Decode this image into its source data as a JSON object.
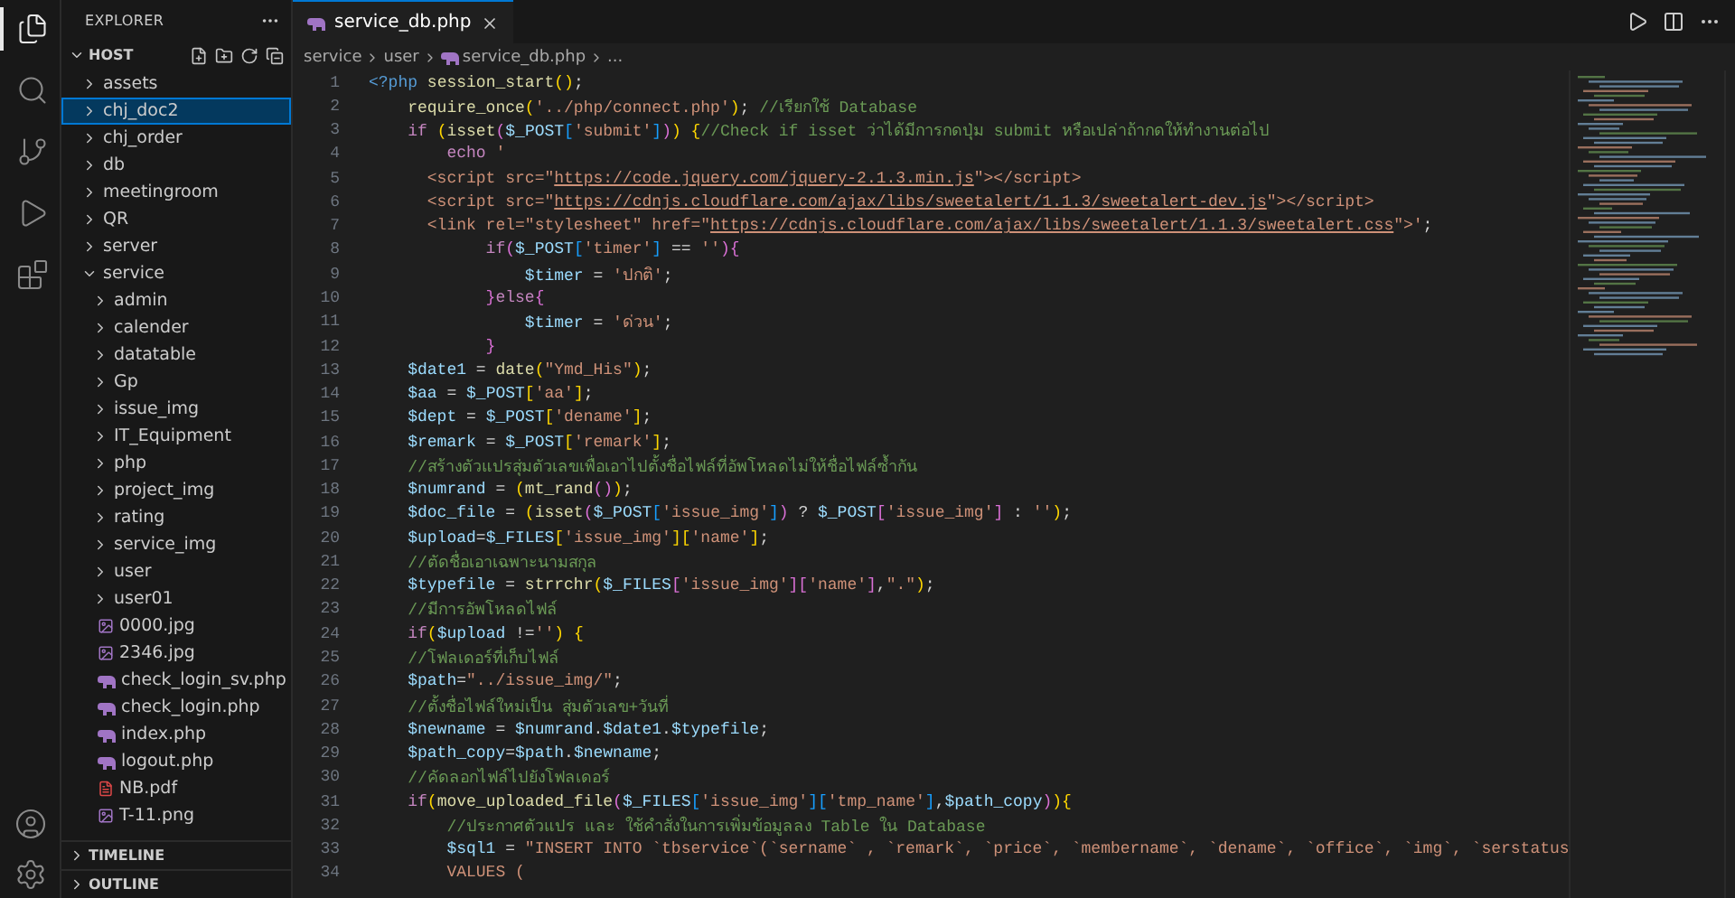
{
  "activity_bar": {
    "items": [
      {
        "kind": "explorer",
        "selected": true
      },
      {
        "kind": "search",
        "selected": false
      },
      {
        "kind": "source-control",
        "selected": false
      },
      {
        "kind": "run-debug",
        "selected": false
      },
      {
        "kind": "extensions",
        "selected": false
      }
    ],
    "bottom_items": [
      {
        "kind": "accounts"
      },
      {
        "kind": "settings"
      }
    ]
  },
  "sidebar": {
    "title": "EXPLORER",
    "section": {
      "title": "HOST",
      "expanded": true
    },
    "tree": [
      {
        "label": "assets",
        "kind": "folder",
        "expanded": false,
        "selected": false
      },
      {
        "label": "chj_doc2",
        "kind": "folder",
        "expanded": false,
        "selected": true
      },
      {
        "label": "chj_order",
        "kind": "folder",
        "expanded": false,
        "selected": false
      },
      {
        "label": "db",
        "kind": "folder",
        "expanded": false,
        "selected": false
      },
      {
        "label": "meetingroom",
        "kind": "folder",
        "expanded": false,
        "selected": false
      },
      {
        "label": "QR",
        "kind": "folder",
        "expanded": false,
        "selected": false
      },
      {
        "label": "server",
        "kind": "folder",
        "expanded": false,
        "selected": false
      },
      {
        "label": "service",
        "kind": "folder",
        "expanded": true,
        "selected": false,
        "children": [
          {
            "label": "admin",
            "kind": "folder",
            "expanded": false,
            "selected": false
          },
          {
            "label": "calender",
            "kind": "folder",
            "expanded": false,
            "selected": false
          },
          {
            "label": "datatable",
            "kind": "folder",
            "expanded": false,
            "selected": false
          },
          {
            "label": "Gp",
            "kind": "folder",
            "expanded": false,
            "selected": false
          },
          {
            "label": "issue_img",
            "kind": "folder",
            "expanded": false,
            "selected": false
          },
          {
            "label": "IT_Equipment",
            "kind": "folder",
            "expanded": false,
            "selected": false
          },
          {
            "label": "php",
            "kind": "folder",
            "expanded": false,
            "selected": false
          },
          {
            "label": "project_img",
            "kind": "folder",
            "expanded": false,
            "selected": false
          },
          {
            "label": "rating",
            "kind": "folder",
            "expanded": false,
            "selected": false
          },
          {
            "label": "service_img",
            "kind": "folder",
            "expanded": false,
            "selected": false
          },
          {
            "label": "user",
            "kind": "folder",
            "expanded": false,
            "selected": false
          },
          {
            "label": "user01",
            "kind": "folder",
            "expanded": false,
            "selected": false
          },
          {
            "label": "0000.jpg",
            "kind": "image",
            "selected": false
          },
          {
            "label": "2346.jpg",
            "kind": "image",
            "selected": false
          },
          {
            "label": "check_login_sv.php",
            "kind": "php",
            "selected": false
          },
          {
            "label": "check_login.php",
            "kind": "php",
            "selected": false
          },
          {
            "label": "index.php",
            "kind": "php",
            "selected": false
          },
          {
            "label": "logout.php",
            "kind": "php",
            "selected": false
          },
          {
            "label": "NB.pdf",
            "kind": "pdf",
            "selected": false
          },
          {
            "label": "T-11.png",
            "kind": "image",
            "selected": false
          }
        ]
      }
    ],
    "panels": [
      {
        "title": "TIMELINE",
        "expanded": false
      },
      {
        "title": "OUTLINE",
        "expanded": false
      }
    ]
  },
  "editor": {
    "tabs": [
      {
        "label": "service_db.php",
        "selected": true
      }
    ],
    "breadcrumb": [
      {
        "kind": "folder",
        "label": "service"
      },
      {
        "kind": "folder",
        "label": "user"
      },
      {
        "kind": "php",
        "label": "service_db.php"
      },
      {
        "kind": "more",
        "label": "..."
      }
    ],
    "lines": [
      {
        "number": "1",
        "tokens": [
          {
            "kind": "tag",
            "text": "<?php"
          },
          {
            "kind": "fn",
            "text": " session_start"
          },
          {
            "kind": "b1",
            "text": "()"
          },
          {
            "kind": "pun",
            "text": ";"
          }
        ]
      },
      {
        "number": "2",
        "tokens": [
          {
            "kind": "fn",
            "text": "    require_once"
          },
          {
            "kind": "b1",
            "text": "("
          },
          {
            "kind": "str",
            "text": "'../php/connect.php'"
          },
          {
            "kind": "b1",
            "text": ")"
          },
          {
            "kind": "pun",
            "text": "; "
          },
          {
            "kind": "cmt",
            "text": "//เรียกใช้ Database"
          }
        ]
      },
      {
        "number": "3",
        "tokens": [
          {
            "kind": "kw",
            "text": "    if "
          },
          {
            "kind": "b1",
            "text": "("
          },
          {
            "kind": "fn",
            "text": "isset"
          },
          {
            "kind": "b2",
            "text": "("
          },
          {
            "kind": "var",
            "text": "$_POST"
          },
          {
            "kind": "b3",
            "text": "["
          },
          {
            "kind": "str",
            "text": "'submit'"
          },
          {
            "kind": "b3",
            "text": "]"
          },
          {
            "kind": "b2",
            "text": ")"
          },
          {
            "kind": "b1",
            "text": ") {"
          },
          {
            "kind": "cmt",
            "text": "//Check if isset ว่าได้มีการกดปุ่ม submit หรือเปล่าถ้ากดให้ทำงานต่อไป"
          }
        ]
      },
      {
        "number": "4",
        "tokens": [
          {
            "kind": "kw",
            "text": "        echo "
          },
          {
            "kind": "str",
            "text": "'"
          }
        ]
      },
      {
        "number": "5",
        "tokens": [
          {
            "kind": "str",
            "text": "      <script src=\""
          },
          {
            "kind": "link",
            "text": "https://code.jquery.com/jquery-2.1.3.min.js"
          },
          {
            "kind": "str",
            "text": "\"></script>"
          }
        ]
      },
      {
        "number": "6",
        "tokens": [
          {
            "kind": "str",
            "text": "      <script src=\""
          },
          {
            "kind": "link",
            "text": "https://cdnjs.cloudflare.com/ajax/libs/sweetalert/1.1.3/sweetalert-dev.js"
          },
          {
            "kind": "str",
            "text": "\"></script>"
          }
        ]
      },
      {
        "number": "7",
        "tokens": [
          {
            "kind": "str",
            "text": "      <link rel=\"stylesheet\" href=\""
          },
          {
            "kind": "link",
            "text": "https://cdnjs.cloudflare.com/ajax/libs/sweetalert/1.1.3/sweetalert.css"
          },
          {
            "kind": "str",
            "text": "\">'"
          },
          {
            "kind": "pun",
            "text": ";"
          }
        ]
      },
      {
        "number": "8",
        "tokens": [
          {
            "kind": "kw",
            "text": "            if"
          },
          {
            "kind": "b2",
            "text": "("
          },
          {
            "kind": "var",
            "text": "$_POST"
          },
          {
            "kind": "b3",
            "text": "["
          },
          {
            "kind": "str",
            "text": "'timer'"
          },
          {
            "kind": "b3",
            "text": "]"
          },
          {
            "kind": "pun",
            "text": " == "
          },
          {
            "kind": "str",
            "text": "''"
          },
          {
            "kind": "b2",
            "text": "){"
          }
        ]
      },
      {
        "number": "9",
        "tokens": [
          {
            "kind": "var",
            "text": "                $timer"
          },
          {
            "kind": "pun",
            "text": " = "
          },
          {
            "kind": "str",
            "text": "'ปกติ'"
          },
          {
            "kind": "pun",
            "text": ";"
          }
        ]
      },
      {
        "number": "10",
        "tokens": [
          {
            "kind": "b2",
            "text": "            }"
          },
          {
            "kind": "kw",
            "text": "else"
          },
          {
            "kind": "b2",
            "text": "{"
          }
        ]
      },
      {
        "number": "11",
        "tokens": [
          {
            "kind": "var",
            "text": "                $timer"
          },
          {
            "kind": "pun",
            "text": " = "
          },
          {
            "kind": "str",
            "text": "'ด่วน'"
          },
          {
            "kind": "pun",
            "text": ";"
          }
        ]
      },
      {
        "number": "12",
        "tokens": [
          {
            "kind": "b2",
            "text": "            }"
          }
        ]
      },
      {
        "number": "13",
        "tokens": [
          {
            "kind": "var",
            "text": "    $date1"
          },
          {
            "kind": "pun",
            "text": " = "
          },
          {
            "kind": "fn",
            "text": "date"
          },
          {
            "kind": "b1",
            "text": "("
          },
          {
            "kind": "str",
            "text": "\"Ymd_His\""
          },
          {
            "kind": "b1",
            "text": ")"
          },
          {
            "kind": "pun",
            "text": ";"
          }
        ]
      },
      {
        "number": "14",
        "tokens": [
          {
            "kind": "var",
            "text": "    $aa"
          },
          {
            "kind": "pun",
            "text": " = "
          },
          {
            "kind": "var",
            "text": "$_POST"
          },
          {
            "kind": "b1",
            "text": "["
          },
          {
            "kind": "str",
            "text": "'aa'"
          },
          {
            "kind": "b1",
            "text": "]"
          },
          {
            "kind": "pun",
            "text": ";"
          }
        ]
      },
      {
        "number": "15",
        "tokens": [
          {
            "kind": "var",
            "text": "    $dept"
          },
          {
            "kind": "pun",
            "text": " = "
          },
          {
            "kind": "var",
            "text": "$_POST"
          },
          {
            "kind": "b1",
            "text": "["
          },
          {
            "kind": "str",
            "text": "'dename'"
          },
          {
            "kind": "b1",
            "text": "]"
          },
          {
            "kind": "pun",
            "text": ";"
          }
        ]
      },
      {
        "number": "16",
        "tokens": [
          {
            "kind": "var",
            "text": "    $remark"
          },
          {
            "kind": "pun",
            "text": " = "
          },
          {
            "kind": "var",
            "text": "$_POST"
          },
          {
            "kind": "b1",
            "text": "["
          },
          {
            "kind": "str",
            "text": "'remark'"
          },
          {
            "kind": "b1",
            "text": "]"
          },
          {
            "kind": "pun",
            "text": ";"
          }
        ]
      },
      {
        "number": "17",
        "tokens": [
          {
            "kind": "cmt",
            "text": "    //สร้างตัวแปรสุ่มตัวเลขเพื่อเอาไปตั้งชื่อไฟล์ที่อัพโหลดไม่ให้ชื่อไฟล์ซ้ำกัน"
          }
        ]
      },
      {
        "number": "18",
        "tokens": [
          {
            "kind": "var",
            "text": "    $numrand"
          },
          {
            "kind": "pun",
            "text": " = "
          },
          {
            "kind": "b1",
            "text": "("
          },
          {
            "kind": "fn",
            "text": "mt_rand"
          },
          {
            "kind": "b2",
            "text": "()"
          },
          {
            "kind": "b1",
            "text": ")"
          },
          {
            "kind": "pun",
            "text": ";"
          }
        ]
      },
      {
        "number": "19",
        "tokens": [
          {
            "kind": "var",
            "text": "    $doc_file"
          },
          {
            "kind": "pun",
            "text": " = "
          },
          {
            "kind": "b1",
            "text": "("
          },
          {
            "kind": "fn",
            "text": "isset"
          },
          {
            "kind": "b2",
            "text": "("
          },
          {
            "kind": "var",
            "text": "$_POST"
          },
          {
            "kind": "b3",
            "text": "["
          },
          {
            "kind": "str",
            "text": "'issue_img'"
          },
          {
            "kind": "b3",
            "text": "]"
          },
          {
            "kind": "b2",
            "text": ")"
          },
          {
            "kind": "pun",
            "text": " ? "
          },
          {
            "kind": "var",
            "text": "$_POST"
          },
          {
            "kind": "b2",
            "text": "["
          },
          {
            "kind": "str",
            "text": "'issue_img'"
          },
          {
            "kind": "b2",
            "text": "]"
          },
          {
            "kind": "pun",
            "text": " : "
          },
          {
            "kind": "str",
            "text": "''"
          },
          {
            "kind": "b1",
            "text": ")"
          },
          {
            "kind": "pun",
            "text": ";"
          }
        ]
      },
      {
        "number": "20",
        "tokens": [
          {
            "kind": "var",
            "text": "    $upload"
          },
          {
            "kind": "pun",
            "text": "="
          },
          {
            "kind": "var",
            "text": "$_FILES"
          },
          {
            "kind": "b1",
            "text": "["
          },
          {
            "kind": "str",
            "text": "'issue_img'"
          },
          {
            "kind": "b1",
            "text": "]["
          },
          {
            "kind": "str",
            "text": "'name'"
          },
          {
            "kind": "b1",
            "text": "]"
          },
          {
            "kind": "pun",
            "text": ";"
          }
        ]
      },
      {
        "number": "21",
        "tokens": [
          {
            "kind": "cmt",
            "text": "    //ตัดชื่อเอาเฉพาะนามสกุล"
          }
        ]
      },
      {
        "number": "22",
        "tokens": [
          {
            "kind": "var",
            "text": "    $typefile"
          },
          {
            "kind": "pun",
            "text": " = "
          },
          {
            "kind": "fn",
            "text": "strrchr"
          },
          {
            "kind": "b1",
            "text": "("
          },
          {
            "kind": "var",
            "text": "$_FILES"
          },
          {
            "kind": "b2",
            "text": "["
          },
          {
            "kind": "str",
            "text": "'issue_img'"
          },
          {
            "kind": "b2",
            "text": "]["
          },
          {
            "kind": "str",
            "text": "'name'"
          },
          {
            "kind": "b2",
            "text": "]"
          },
          {
            "kind": "pun",
            "text": ","
          },
          {
            "kind": "str",
            "text": "\".\""
          },
          {
            "kind": "b1",
            "text": ")"
          },
          {
            "kind": "pun",
            "text": ";"
          }
        ]
      },
      {
        "number": "23",
        "tokens": [
          {
            "kind": "cmt",
            "text": "    //มีการอัพโหลดไฟล์"
          }
        ]
      },
      {
        "number": "24",
        "tokens": [
          {
            "kind": "kw",
            "text": "    if"
          },
          {
            "kind": "b1",
            "text": "("
          },
          {
            "kind": "var",
            "text": "$upload"
          },
          {
            "kind": "pun",
            "text": " !="
          },
          {
            "kind": "str",
            "text": "''"
          },
          {
            "kind": "b1",
            "text": ") {"
          }
        ]
      },
      {
        "number": "25",
        "tokens": [
          {
            "kind": "cmt",
            "text": "    //โฟลเดอร์ที่เก็บไฟล์"
          }
        ]
      },
      {
        "number": "26",
        "tokens": [
          {
            "kind": "var",
            "text": "    $path"
          },
          {
            "kind": "pun",
            "text": "="
          },
          {
            "kind": "str",
            "text": "\"../issue_img/\""
          },
          {
            "kind": "pun",
            "text": ";"
          }
        ]
      },
      {
        "number": "27",
        "tokens": [
          {
            "kind": "cmt",
            "text": "    //ตั้งชื่อไฟล์ใหม่เป็น สุ่มตัวเลข+วันที่"
          }
        ]
      },
      {
        "number": "28",
        "tokens": [
          {
            "kind": "var",
            "text": "    $newname"
          },
          {
            "kind": "pun",
            "text": " = "
          },
          {
            "kind": "var",
            "text": "$numrand"
          },
          {
            "kind": "pun",
            "text": "."
          },
          {
            "kind": "var",
            "text": "$date1"
          },
          {
            "kind": "pun",
            "text": "."
          },
          {
            "kind": "var",
            "text": "$typefile"
          },
          {
            "kind": "pun",
            "text": ";"
          }
        ]
      },
      {
        "number": "29",
        "tokens": [
          {
            "kind": "var",
            "text": "    $path_copy"
          },
          {
            "kind": "pun",
            "text": "="
          },
          {
            "kind": "var",
            "text": "$path"
          },
          {
            "kind": "pun",
            "text": "."
          },
          {
            "kind": "var",
            "text": "$newname"
          },
          {
            "kind": "pun",
            "text": ";"
          }
        ]
      },
      {
        "number": "30",
        "tokens": [
          {
            "kind": "cmt",
            "text": "    //คัดลอกไฟล์ไปยังโฟลเดอร์"
          }
        ]
      },
      {
        "number": "31",
        "tokens": [
          {
            "kind": "kw",
            "text": "    if"
          },
          {
            "kind": "b1",
            "text": "("
          },
          {
            "kind": "fn",
            "text": "move_uploaded_file"
          },
          {
            "kind": "b2",
            "text": "("
          },
          {
            "kind": "var",
            "text": "$_FILES"
          },
          {
            "kind": "b3",
            "text": "["
          },
          {
            "kind": "str",
            "text": "'issue_img'"
          },
          {
            "kind": "b3",
            "text": "]["
          },
          {
            "kind": "str",
            "text": "'tmp_name'"
          },
          {
            "kind": "b3",
            "text": "]"
          },
          {
            "kind": "pun",
            "text": ","
          },
          {
            "kind": "var",
            "text": "$path_copy"
          },
          {
            "kind": "b2",
            "text": ")"
          },
          {
            "kind": "b1",
            "text": "){"
          }
        ]
      },
      {
        "number": "32",
        "tokens": [
          {
            "kind": "cmt",
            "text": "        //ประกาศตัวแปร และ ใช้คำสั่งในการเพิ่มข้อมูลลง Table ใน Database"
          }
        ]
      },
      {
        "number": "33",
        "tokens": [
          {
            "kind": "var",
            "text": "        $sql1"
          },
          {
            "kind": "pun",
            "text": " = "
          },
          {
            "kind": "str",
            "text": "\"INSERT INTO `tbservice`(`sername` , `remark`, `price`, `membername`, `dename`, `office`, `img`, `serstatus"
          }
        ]
      },
      {
        "number": "34",
        "tokens": [
          {
            "kind": "str",
            "text": "        VALUES ("
          }
        ]
      }
    ]
  }
}
